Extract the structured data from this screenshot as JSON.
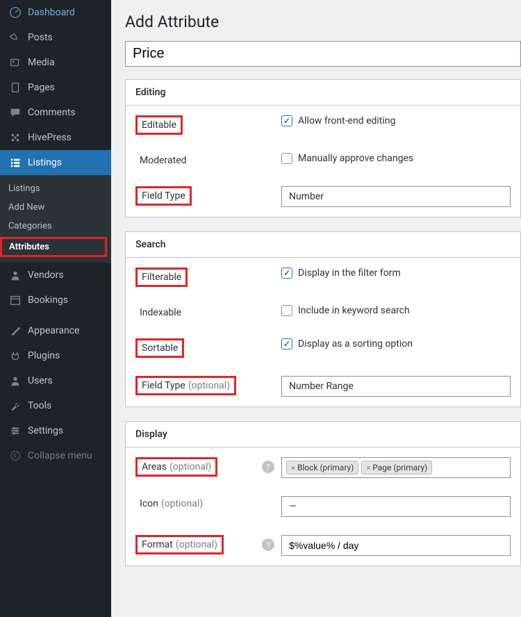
{
  "sidebar": {
    "dashboard": "Dashboard",
    "posts": "Posts",
    "media": "Media",
    "pages": "Pages",
    "comments": "Comments",
    "hivepress": "HivePress",
    "listings": "Listings",
    "listings_sub": [
      "Listings",
      "Add New",
      "Categories",
      "Attributes"
    ],
    "vendors": "Vendors",
    "bookings": "Bookings",
    "appearance": "Appearance",
    "plugins": "Plugins",
    "users": "Users",
    "tools": "Tools",
    "settings": "Settings",
    "collapse": "Collapse menu"
  },
  "page": {
    "title": "Add Attribute",
    "name_value": "Price"
  },
  "editing": {
    "header": "Editing",
    "editable_label": "Editable",
    "editable_desc": "Allow front-end editing",
    "editable_checked": true,
    "moderated_label": "Moderated",
    "moderated_desc": "Manually approve changes",
    "moderated_checked": false,
    "fieldtype_label": "Field Type",
    "fieldtype_value": "Number"
  },
  "search": {
    "header": "Search",
    "filterable_label": "Filterable",
    "filterable_desc": "Display in the filter form",
    "filterable_checked": true,
    "indexable_label": "Indexable",
    "indexable_desc": "Include in keyword search",
    "indexable_checked": false,
    "sortable_label": "Sortable",
    "sortable_desc": "Display as a sorting option",
    "sortable_checked": true,
    "fieldtype_label": "Field Type",
    "fieldtype_opt": "(optional)",
    "fieldtype_value": "Number Range"
  },
  "display": {
    "header": "Display",
    "areas_label": "Areas",
    "areas_opt": "(optional)",
    "areas_tags": [
      "Block (primary)",
      "Page (primary)"
    ],
    "icon_label": "Icon",
    "icon_opt": "(optional)",
    "icon_value": "—",
    "format_label": "Format",
    "format_opt": "(optional)",
    "format_value": "$%value% / day"
  }
}
